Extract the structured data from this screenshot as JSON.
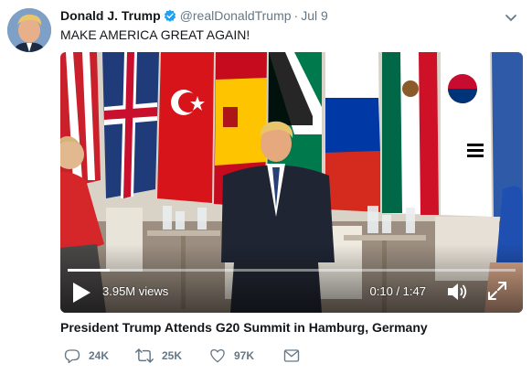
{
  "tweet": {
    "author_name": "Donald J. Trump",
    "handle": "@realDonaldTrump",
    "separator": "·",
    "date": "Jul 9",
    "text": "MAKE AMERICA GREAT AGAIN!",
    "verified_icon": "verified-badge-icon",
    "menu_icon": "chevron-down-icon"
  },
  "video": {
    "views": "3.95M views",
    "time": "0:10 / 1:47",
    "progress": 0.093,
    "title": "President Trump Attends G20 Summit in Hamburg, Germany",
    "icons": [
      "play-icon",
      "volume-icon",
      "fullscreen-icon"
    ]
  },
  "actions": {
    "reply_count": "24K",
    "retweet_count": "25K",
    "like_count": "97K",
    "icons": [
      "reply-icon",
      "retweet-icon",
      "like-icon",
      "direct-message-icon"
    ]
  },
  "colors": {
    "accent": "#1da1f2",
    "text": "#14171a",
    "muted": "#657786"
  }
}
